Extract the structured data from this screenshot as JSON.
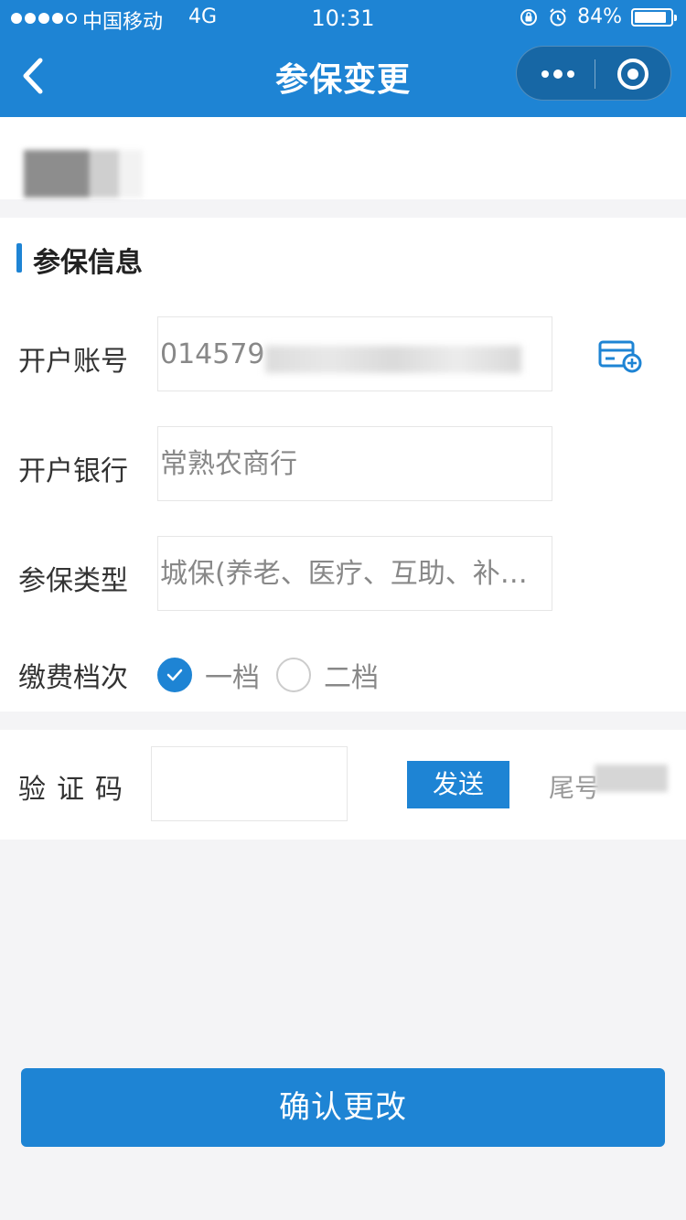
{
  "status_bar": {
    "carrier": "中国移动",
    "network": "4G",
    "time": "10:31",
    "battery": "84%"
  },
  "nav": {
    "title": "参保变更"
  },
  "section": {
    "title": "参保信息",
    "fields": {
      "account_label": "开户账号",
      "account_value": "014579",
      "bank_label": "开户银行",
      "bank_value": "常熟农商行",
      "type_label": "参保类型",
      "type_value": "城保(养老、医疗、互助、补…",
      "level_label": "缴费档次"
    },
    "levels": [
      {
        "label": "一档",
        "checked": true
      },
      {
        "label": "二档",
        "checked": false
      }
    ]
  },
  "verify": {
    "label": "验证码",
    "input_value": "",
    "send_label": "发送",
    "tail_label": "尾号"
  },
  "confirm_label": "确认更改",
  "colors": {
    "accent": "#1e84d4",
    "background": "#f4f4f6"
  }
}
